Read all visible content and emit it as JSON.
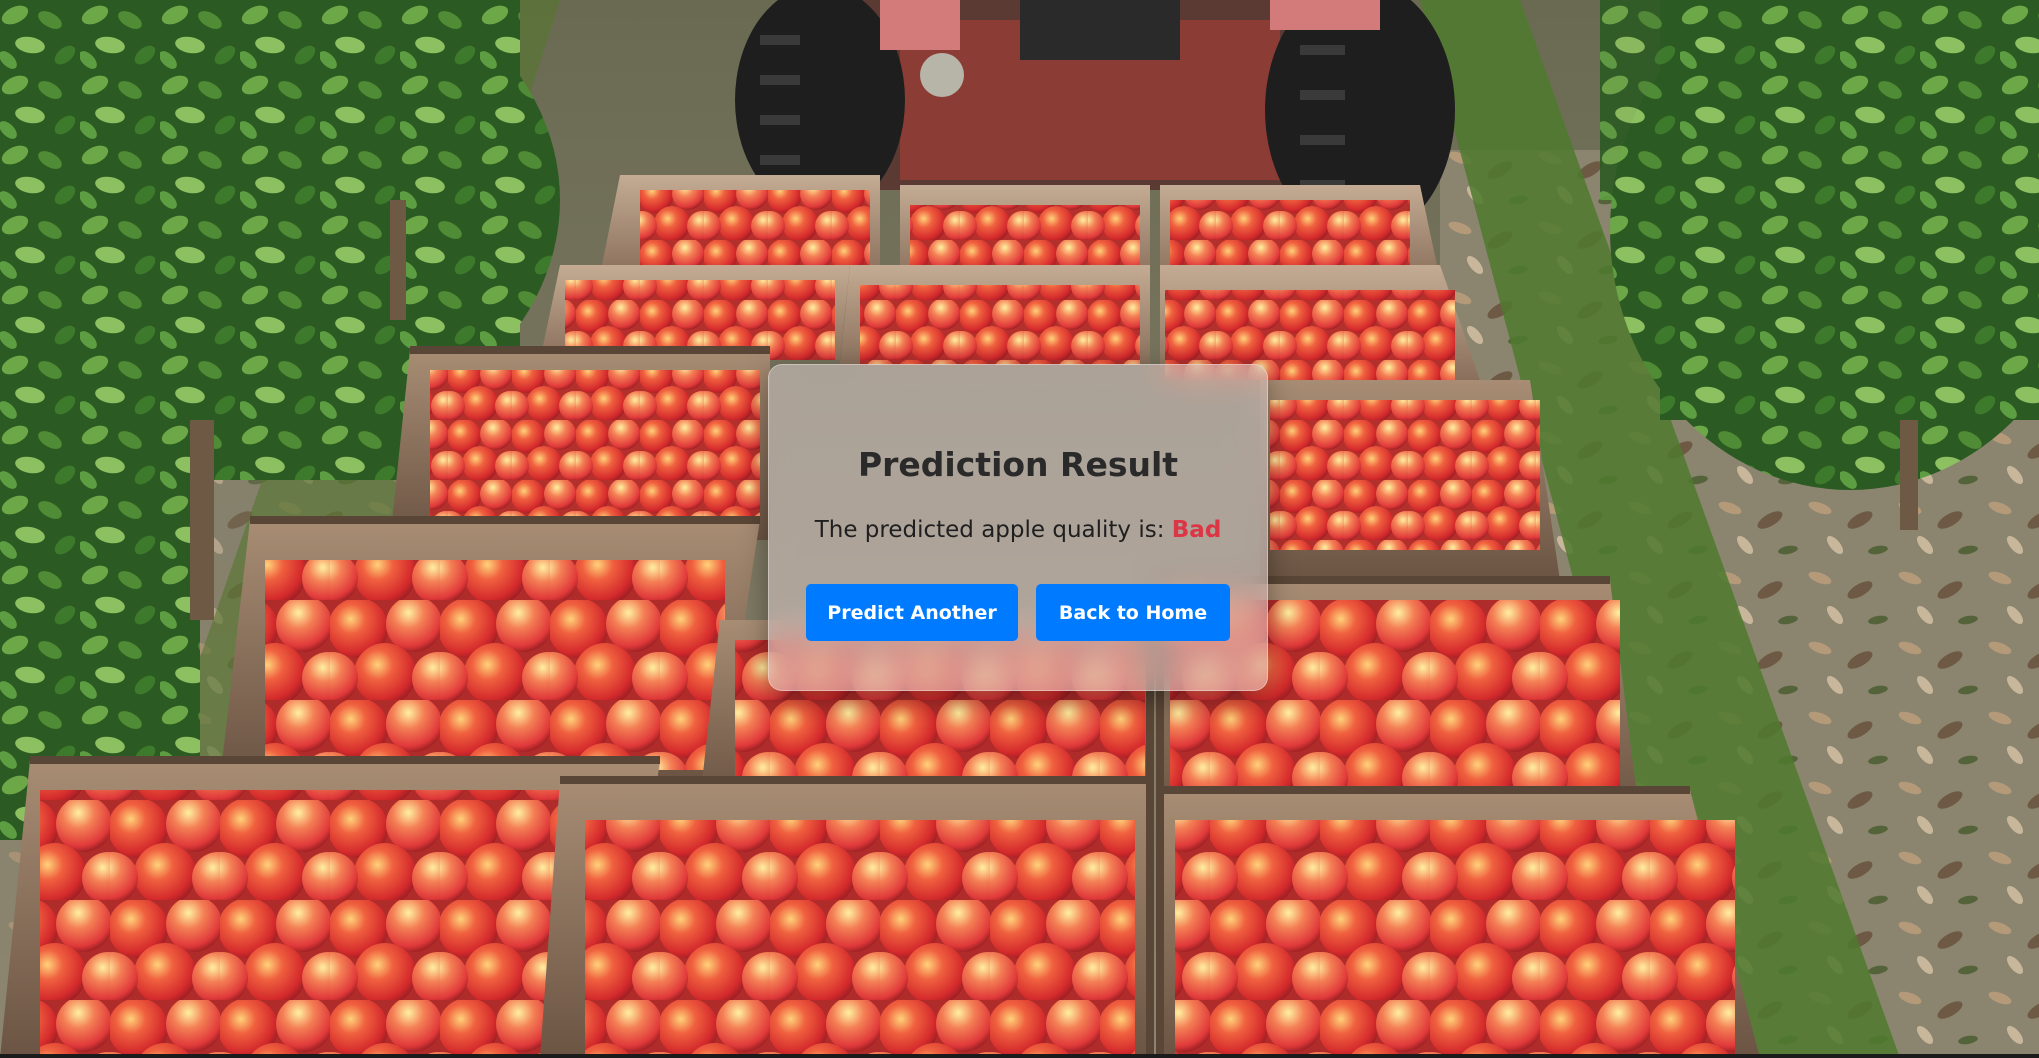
{
  "result_card": {
    "title": "Prediction Result",
    "message_prefix": "The predicted apple quality is:",
    "quality_value": "Bad",
    "predict_another_label": "Predict Another",
    "back_home_label": "Back to Home"
  },
  "colors": {
    "button_bg": "#007bff",
    "button_text": "#ffffff",
    "bad_value": "#dc3545",
    "title_text": "#2a2a2a"
  }
}
